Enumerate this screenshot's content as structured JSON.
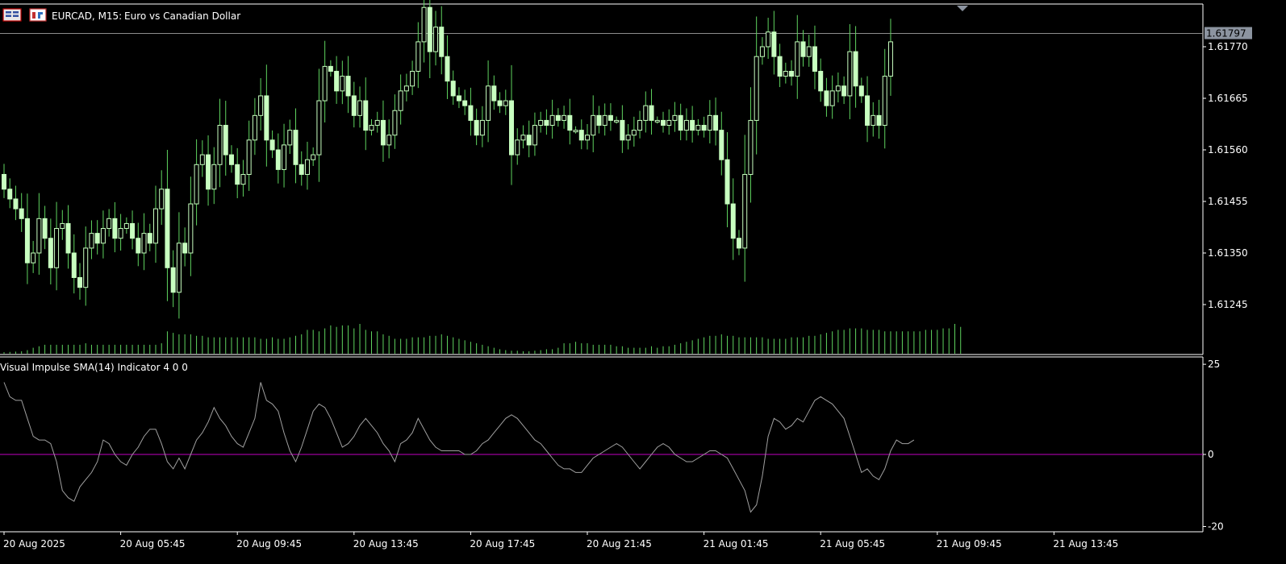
{
  "chart_title": {
    "symbol": "EURCAD, M15:",
    "description": "Euro vs Canadian Dollar"
  },
  "indicator_title": "Visual Impulse SMA(14) Indicator 4 0 0",
  "current_price_label": "1.61797",
  "colors": {
    "background": "#000000",
    "candle": "#c8ffc0",
    "wick": "#5fd35f",
    "volume": "#5fd35f",
    "price_line": "#8c8c8c",
    "frame": "#ffffff",
    "price_tag_bg": "#8c94a0",
    "impulse_line": "#a0a0a0",
    "zero_line": "#c000c0"
  },
  "icons": [
    "chart-window-icon",
    "symbol-icon",
    "price-marker-icon"
  ],
  "chart_data": [
    {
      "type": "candlestick",
      "timeframe": "M15",
      "ylim": [
        1.6116,
        1.6192
      ],
      "y_ticks": [
        "1.61770",
        "1.61665",
        "1.61560",
        "1.61455",
        "1.61350",
        "1.61245"
      ],
      "y_tick_values": [
        1.6177,
        1.61665,
        1.6156,
        1.61455,
        1.6135,
        1.61245
      ],
      "current_price": 1.61797,
      "x_ticks": [
        "20 Aug 2025",
        "20 Aug 05:45",
        "20 Aug 09:45",
        "20 Aug 13:45",
        "20 Aug 17:45",
        "20 Aug 21:45",
        "21 Aug 01:45",
        "21 Aug 05:45",
        "21 Aug 09:45",
        "21 Aug 13:45"
      ],
      "x_tick_bar_index": [
        0,
        20,
        40,
        60,
        80,
        100,
        120,
        140,
        160,
        180
      ],
      "close": [
        1.6148,
        1.6146,
        1.6144,
        1.6142,
        1.6133,
        1.6135,
        1.6142,
        1.6138,
        1.6132,
        1.614,
        1.6141,
        1.6135,
        1.613,
        1.6128,
        1.6136,
        1.6139,
        1.6137,
        1.614,
        1.6142,
        1.6138,
        1.614,
        1.6141,
        1.6138,
        1.6135,
        1.6139,
        1.6137,
        1.6144,
        1.6148,
        1.6132,
        1.6127,
        1.6137,
        1.6135,
        1.6145,
        1.6153,
        1.6155,
        1.6148,
        1.6153,
        1.6161,
        1.6155,
        1.6153,
        1.6149,
        1.6151,
        1.6158,
        1.6163,
        1.6167,
        1.6158,
        1.6156,
        1.6152,
        1.6157,
        1.616,
        1.6153,
        1.6151,
        1.6154,
        1.6155,
        1.6166,
        1.6173,
        1.6172,
        1.6168,
        1.6171,
        1.6167,
        1.6163,
        1.6166,
        1.616,
        1.6161,
        1.6162,
        1.6157,
        1.6159,
        1.6164,
        1.6168,
        1.6169,
        1.6172,
        1.6178,
        1.6185,
        1.6176,
        1.6181,
        1.6175,
        1.617,
        1.6167,
        1.6166,
        1.6165,
        1.6162,
        1.6159,
        1.6162,
        1.6169,
        1.6166,
        1.6165,
        1.6166,
        1.6155,
        1.6158,
        1.6159,
        1.6157,
        1.6161,
        1.6162,
        1.6161,
        1.6163,
        1.6162,
        1.6163,
        1.616,
        1.616,
        1.6158,
        1.6159,
        1.6163,
        1.6161,
        1.6163,
        1.6162,
        1.6162,
        1.6158,
        1.6159,
        1.616,
        1.6162,
        1.6165,
        1.6162,
        1.6162,
        1.6161,
        1.6162,
        1.6163,
        1.616,
        1.6162,
        1.616,
        1.6161,
        1.616,
        1.6163,
        1.616,
        1.6154,
        1.6145,
        1.6138,
        1.6136,
        1.6151,
        1.6162,
        1.6175,
        1.6177,
        1.618,
        1.6175,
        1.6171,
        1.6172,
        1.6171,
        1.6178,
        1.6175,
        1.6177,
        1.6172,
        1.6168,
        1.6165,
        1.6168,
        1.6169,
        1.6167,
        1.6176,
        1.6169,
        1.6167,
        1.6161,
        1.6163,
        1.6161,
        1.6171,
        1.6178
      ],
      "volume": [
        {
          "bar": 0,
          "h": 0.05
        },
        {
          "bar": 1,
          "h": 0.06
        },
        {
          "bar": 2,
          "h": 0.07
        },
        {
          "bar": 3,
          "h": 0.08
        },
        {
          "bar": 4,
          "h": 0.12
        },
        {
          "bar": 5,
          "h": 0.2
        },
        {
          "bar": 6,
          "h": 0.25
        },
        {
          "bar": 7,
          "h": 0.3
        },
        {
          "bar": 8,
          "h": 0.3
        },
        {
          "bar": 9,
          "h": 0.3
        },
        {
          "bar": 10,
          "h": 0.3
        },
        {
          "bar": 11,
          "h": 0.3
        },
        {
          "bar": 12,
          "h": 0.3
        },
        {
          "bar": 13,
          "h": 0.3
        },
        {
          "bar": 14,
          "h": 0.35
        },
        {
          "bar": 15,
          "h": 0.3
        },
        {
          "bar": 16,
          "h": 0.3
        },
        {
          "bar": 17,
          "h": 0.3
        },
        {
          "bar": 18,
          "h": 0.3
        },
        {
          "bar": 19,
          "h": 0.3
        },
        {
          "bar": 20,
          "h": 0.3
        },
        {
          "bar": 21,
          "h": 0.3
        },
        {
          "bar": 22,
          "h": 0.3
        },
        {
          "bar": 23,
          "h": 0.3
        },
        {
          "bar": 24,
          "h": 0.3
        },
        {
          "bar": 25,
          "h": 0.3
        },
        {
          "bar": 26,
          "h": 0.3
        },
        {
          "bar": 27,
          "h": 0.35
        },
        {
          "bar": 28,
          "h": 0.75
        },
        {
          "bar": 29,
          "h": 0.7
        },
        {
          "bar": 30,
          "h": 0.65
        },
        {
          "bar": 31,
          "h": 0.65
        },
        {
          "bar": 32,
          "h": 0.65
        },
        {
          "bar": 33,
          "h": 0.6
        },
        {
          "bar": 34,
          "h": 0.6
        },
        {
          "bar": 35,
          "h": 0.55
        },
        {
          "bar": 36,
          "h": 0.55
        },
        {
          "bar": 37,
          "h": 0.55
        },
        {
          "bar": 38,
          "h": 0.55
        },
        {
          "bar": 39,
          "h": 0.55
        },
        {
          "bar": 40,
          "h": 0.55
        },
        {
          "bar": 41,
          "h": 0.55
        },
        {
          "bar": 42,
          "h": 0.55
        },
        {
          "bar": 43,
          "h": 0.55
        },
        {
          "bar": 44,
          "h": 0.5
        },
        {
          "bar": 45,
          "h": 0.5
        },
        {
          "bar": 46,
          "h": 0.55
        },
        {
          "bar": 47,
          "h": 0.5
        },
        {
          "bar": 48,
          "h": 0.5
        },
        {
          "bar": 49,
          "h": 0.55
        },
        {
          "bar": 50,
          "h": 0.6
        },
        {
          "bar": 51,
          "h": 0.65
        },
        {
          "bar": 52,
          "h": 0.8
        },
        {
          "bar": 53,
          "h": 0.8
        },
        {
          "bar": 54,
          "h": 0.75
        },
        {
          "bar": 55,
          "h": 0.85
        },
        {
          "bar": 56,
          "h": 0.95
        },
        {
          "bar": 57,
          "h": 0.9
        },
        {
          "bar": 58,
          "h": 0.95
        },
        {
          "bar": 59,
          "h": 0.95
        },
        {
          "bar": 60,
          "h": 0.85
        },
        {
          "bar": 61,
          "h": 1.0
        },
        {
          "bar": 62,
          "h": 0.8
        },
        {
          "bar": 63,
          "h": 0.75
        },
        {
          "bar": 64,
          "h": 0.75
        },
        {
          "bar": 65,
          "h": 0.65
        },
        {
          "bar": 66,
          "h": 0.6
        },
        {
          "bar": 67,
          "h": 0.5
        },
        {
          "bar": 68,
          "h": 0.5
        },
        {
          "bar": 69,
          "h": 0.5
        },
        {
          "bar": 70,
          "h": 0.55
        },
        {
          "bar": 71,
          "h": 0.55
        },
        {
          "bar": 72,
          "h": 0.55
        },
        {
          "bar": 73,
          "h": 0.6
        },
        {
          "bar": 74,
          "h": 0.6
        },
        {
          "bar": 75,
          "h": 0.65
        },
        {
          "bar": 76,
          "h": 0.6
        },
        {
          "bar": 77,
          "h": 0.55
        },
        {
          "bar": 78,
          "h": 0.5
        },
        {
          "bar": 79,
          "h": 0.45
        },
        {
          "bar": 80,
          "h": 0.4
        },
        {
          "bar": 81,
          "h": 0.35
        },
        {
          "bar": 82,
          "h": 0.3
        },
        {
          "bar": 83,
          "h": 0.25
        },
        {
          "bar": 84,
          "h": 0.2
        },
        {
          "bar": 85,
          "h": 0.15
        },
        {
          "bar": 86,
          "h": 0.12
        },
        {
          "bar": 87,
          "h": 0.1
        },
        {
          "bar": 88,
          "h": 0.1
        },
        {
          "bar": 89,
          "h": 0.08
        },
        {
          "bar": 90,
          "h": 0.08
        },
        {
          "bar": 91,
          "h": 0.1
        },
        {
          "bar": 92,
          "h": 0.12
        },
        {
          "bar": 93,
          "h": 0.15
        },
        {
          "bar": 94,
          "h": 0.15
        },
        {
          "bar": 95,
          "h": 0.2
        },
        {
          "bar": 96,
          "h": 0.35
        },
        {
          "bar": 97,
          "h": 0.35
        },
        {
          "bar": 98,
          "h": 0.4
        },
        {
          "bar": 99,
          "h": 0.35
        },
        {
          "bar": 100,
          "h": 0.35
        },
        {
          "bar": 101,
          "h": 0.3
        },
        {
          "bar": 102,
          "h": 0.3
        },
        {
          "bar": 103,
          "h": 0.3
        },
        {
          "bar": 104,
          "h": 0.3
        },
        {
          "bar": 105,
          "h": 0.25
        },
        {
          "bar": 106,
          "h": 0.25
        },
        {
          "bar": 107,
          "h": 0.2
        },
        {
          "bar": 108,
          "h": 0.2
        },
        {
          "bar": 109,
          "h": 0.2
        },
        {
          "bar": 110,
          "h": 0.2
        },
        {
          "bar": 111,
          "h": 0.25
        },
        {
          "bar": 112,
          "h": 0.2
        },
        {
          "bar": 113,
          "h": 0.25
        },
        {
          "bar": 114,
          "h": 0.25
        },
        {
          "bar": 115,
          "h": 0.3
        },
        {
          "bar": 116,
          "h": 0.35
        },
        {
          "bar": 117,
          "h": 0.4
        },
        {
          "bar": 118,
          "h": 0.45
        },
        {
          "bar": 119,
          "h": 0.5
        },
        {
          "bar": 120,
          "h": 0.55
        },
        {
          "bar": 121,
          "h": 0.6
        },
        {
          "bar": 122,
          "h": 0.6
        },
        {
          "bar": 123,
          "h": 0.65
        },
        {
          "bar": 124,
          "h": 0.6
        },
        {
          "bar": 125,
          "h": 0.6
        },
        {
          "bar": 126,
          "h": 0.55
        },
        {
          "bar": 127,
          "h": 0.55
        },
        {
          "bar": 128,
          "h": 0.55
        },
        {
          "bar": 129,
          "h": 0.55
        },
        {
          "bar": 130,
          "h": 0.55
        },
        {
          "bar": 131,
          "h": 0.5
        },
        {
          "bar": 132,
          "h": 0.5
        },
        {
          "bar": 133,
          "h": 0.5
        },
        {
          "bar": 134,
          "h": 0.5
        },
        {
          "bar": 135,
          "h": 0.55
        },
        {
          "bar": 136,
          "h": 0.55
        },
        {
          "bar": 137,
          "h": 0.55
        },
        {
          "bar": 138,
          "h": 0.6
        },
        {
          "bar": 139,
          "h": 0.6
        },
        {
          "bar": 140,
          "h": 0.65
        },
        {
          "bar": 141,
          "h": 0.7
        },
        {
          "bar": 142,
          "h": 0.75
        },
        {
          "bar": 143,
          "h": 0.8
        },
        {
          "bar": 144,
          "h": 0.8
        },
        {
          "bar": 145,
          "h": 0.85
        },
        {
          "bar": 146,
          "h": 0.85
        },
        {
          "bar": 147,
          "h": 0.85
        },
        {
          "bar": 148,
          "h": 0.8
        },
        {
          "bar": 149,
          "h": 0.8
        },
        {
          "bar": 150,
          "h": 0.8
        },
        {
          "bar": 151,
          "h": 0.75
        },
        {
          "bar": 152,
          "h": 0.75
        },
        {
          "bar": 153,
          "h": 0.75
        },
        {
          "bar": 154,
          "h": 0.75
        },
        {
          "bar": 155,
          "h": 0.75
        },
        {
          "bar": 156,
          "h": 0.75
        },
        {
          "bar": 157,
          "h": 0.75
        },
        {
          "bar": 158,
          "h": 0.8
        },
        {
          "bar": 159,
          "h": 0.8
        },
        {
          "bar": 160,
          "h": 0.8
        },
        {
          "bar": 161,
          "h": 0.85
        },
        {
          "bar": 162,
          "h": 0.85
        },
        {
          "bar": 163,
          "h": 1.0
        },
        {
          "bar": 164,
          "h": 0.9
        }
      ]
    },
    {
      "type": "line",
      "name": "Visual Impulse SMA(14) Indicator 4 0 0",
      "ylim": [
        -20,
        25
      ],
      "y_ticks": [
        "25",
        "0",
        "-20"
      ],
      "y_tick_values": [
        25,
        0,
        -20
      ],
      "zero_line": 0,
      "x": [
        0,
        1,
        2,
        3,
        4,
        5,
        6,
        7,
        8,
        9,
        10,
        11,
        12,
        13,
        14,
        15,
        16,
        17,
        18,
        19,
        20,
        21,
        22,
        23,
        24,
        25,
        26,
        27,
        28,
        29,
        30,
        31,
        32,
        33,
        34,
        35,
        36,
        37,
        38,
        39,
        40,
        41,
        42,
        43,
        44,
        45,
        46,
        47,
        48,
        49,
        50,
        51,
        52,
        53,
        54,
        55,
        56,
        57,
        58,
        59,
        60,
        61,
        62,
        63,
        64,
        65,
        66,
        67,
        68,
        69,
        70,
        71,
        72,
        73,
        74,
        75,
        76,
        77,
        78,
        79,
        80,
        81,
        82,
        83,
        84,
        85,
        86,
        87,
        88,
        89,
        90,
        91,
        92,
        93,
        94,
        95,
        96,
        97,
        98,
        99,
        100,
        101,
        102,
        103,
        104,
        105,
        106,
        107,
        108,
        109,
        110,
        111,
        112,
        113,
        114,
        115,
        116,
        117,
        118,
        119,
        120,
        121,
        122,
        123,
        124,
        125,
        126,
        127,
        128,
        129,
        130,
        131,
        132,
        133,
        134,
        135,
        136,
        137,
        138,
        139,
        140,
        141,
        142,
        143,
        144,
        145,
        146,
        147,
        148,
        149,
        150,
        151,
        152,
        153,
        154,
        155,
        156,
        157,
        158,
        159,
        160,
        161,
        162,
        163,
        164
      ],
      "values": [
        20,
        16,
        15,
        15,
        10,
        5,
        4,
        4,
        3,
        -2,
        -10,
        -12,
        -13,
        -9,
        -7,
        -5,
        -2,
        4,
        3,
        0,
        -2,
        -3,
        0,
        2,
        5,
        7,
        7,
        3,
        -2,
        -4,
        -1,
        -4,
        0,
        4,
        6,
        9,
        13,
        10,
        8,
        5,
        3,
        2,
        6,
        10,
        20,
        15,
        14,
        12,
        6,
        1,
        -2,
        2,
        7,
        12,
        14,
        13,
        10,
        6,
        2,
        3,
        5,
        8,
        10,
        8,
        6,
        3,
        1,
        -2,
        3,
        4,
        6,
        10,
        7,
        4,
        2,
        1,
        1,
        1,
        1,
        0,
        0,
        1,
        3,
        4,
        6,
        8,
        10,
        11,
        10,
        8,
        6,
        4,
        3,
        1,
        -1,
        -3,
        -4,
        -4,
        -5,
        -5,
        -3,
        -1,
        0,
        1,
        2,
        3,
        2,
        0,
        -2,
        -4,
        -2,
        0,
        2,
        3,
        2,
        0,
        -1,
        -2,
        -2,
        -1,
        0,
        1,
        1,
        0,
        -1,
        -4,
        -7,
        -10,
        -16,
        -14,
        -6,
        5,
        10,
        9,
        7,
        8,
        10,
        9,
        12,
        15,
        16,
        15,
        14,
        12,
        10,
        5,
        0,
        -5,
        -4,
        -6,
        -7,
        -4,
        1,
        4,
        3,
        3,
        4
      ]
    }
  ]
}
